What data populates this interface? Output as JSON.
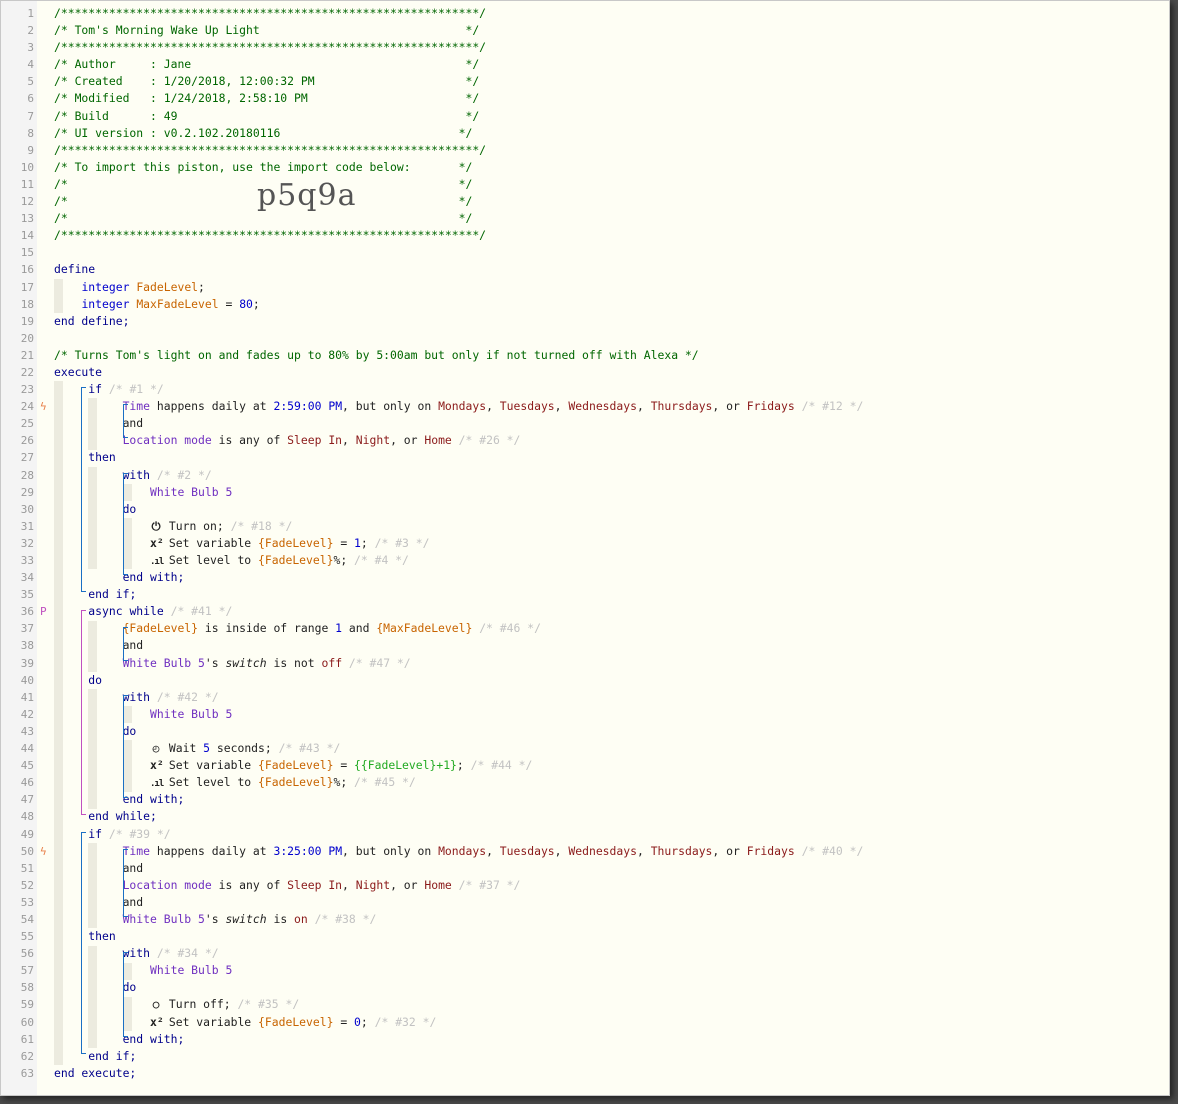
{
  "editor": {
    "header": {
      "stars": "/*************************************************************/",
      "title_line": "/* Tom's Morning Wake Up Light                              */",
      "author_line": "/* Author     : Jane                                        */",
      "created_line": "/* Created    : 1/20/2018, 12:00:32 PM                      */",
      "modified_line": "/* Modified   : 1/24/2018, 2:58:10 PM                       */",
      "build_line": "/* Build      : 49                                          */",
      "ui_line": "/* UI version : v0.2.102.20180116                          */",
      "import_line": "/* To import this piston, use the import code below:       */",
      "blank_line": "/*                                                         */",
      "import_code": "p5q9a"
    },
    "define": {
      "open": "define",
      "type": "integer",
      "var1": "FadeLevel",
      "var2": "MaxFadeLevel",
      "var2_value": "80",
      "close": "end define;"
    },
    "comment": "/* Turns Tom's light on and fades up to 80% by 5:00am but only if not turned off with Alexa */",
    "execute": "execute",
    "end_execute": "end execute;",
    "device": "White Bulb 5",
    "days": [
      "Mondays",
      "Tuesdays",
      "Wednesdays",
      "Thursdays",
      "Fridays"
    ],
    "modes": [
      "Sleep In",
      "Night",
      "Home"
    ],
    "if1": {
      "id": "/* #1 */",
      "time": "2:59:00 PM",
      "cond_id": "/* #12 */",
      "mode_id": "/* #26 */",
      "with_id": "/* #2 */",
      "turn_on_id": "/* #18 */",
      "set_var_value": "1",
      "set_var_id": "/* #3 */",
      "set_level_id": "/* #4 */"
    },
    "while": {
      "id": "/* #41 */",
      "range_id": "/* #46 */",
      "range_low": "1",
      "switch_id": "/* #47 */",
      "switch_value": "off",
      "with_id": "/* #42 */",
      "wait_value": "5",
      "wait_id": "/* #43 */",
      "expr": "{{FadeLevel}+1}",
      "set_var_id": "/* #44 */",
      "set_level_id": "/* #45 */"
    },
    "if2": {
      "id": "/* #39 */",
      "time": "3:25:00 PM",
      "cond_id": "/* #40 */",
      "mode_id": "/* #37 */",
      "switch_value": "on",
      "switch_id": "/* #38 */",
      "with_id": "/* #34 */",
      "turn_off_id": "/* #35 */",
      "set_var_value": "0",
      "set_var_id": "/* #32 */"
    },
    "line_count": 63
  }
}
